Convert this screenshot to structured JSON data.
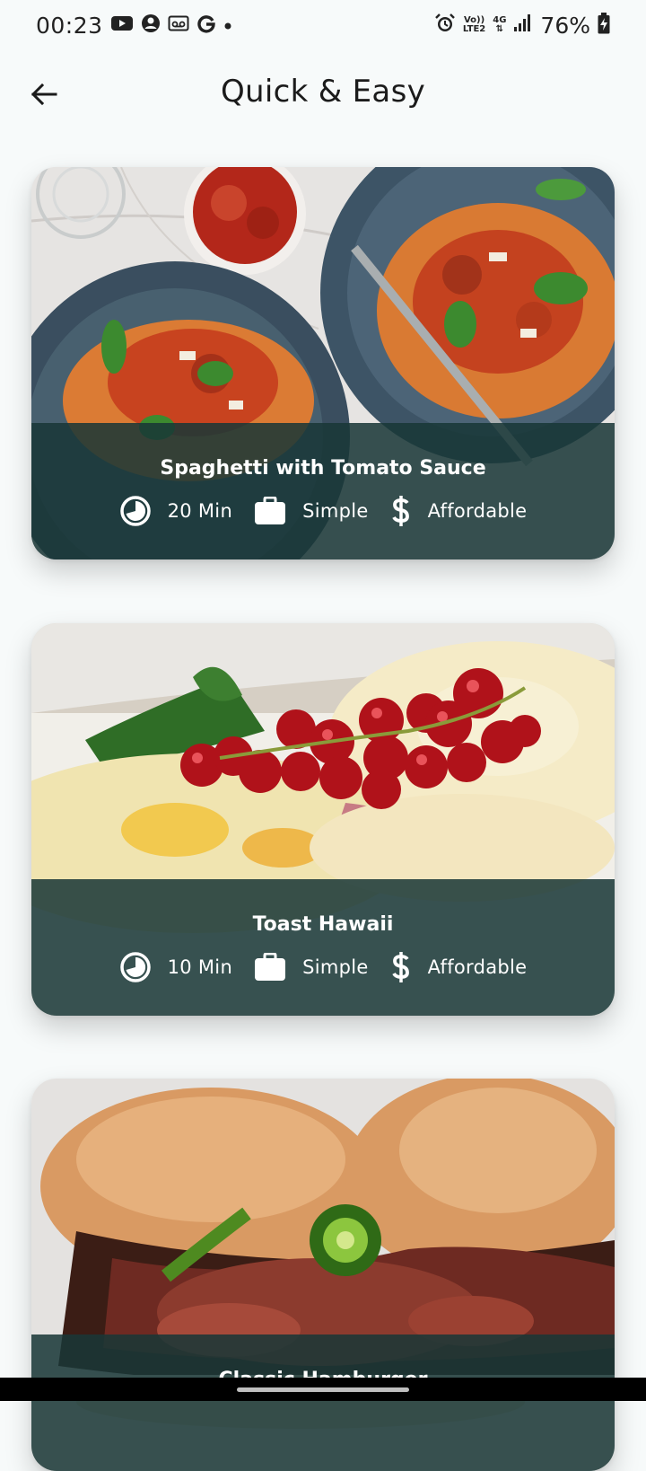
{
  "status_bar": {
    "time": "00:23",
    "battery_percent": "76%",
    "network_top": "Vo))",
    "network_bottom": "LTE2",
    "generation": "4G",
    "left_icons": [
      "youtube-icon",
      "account-circle-icon",
      "voicemail-icon",
      "google-icon",
      "dot-icon"
    ],
    "right_icons": [
      "alarm-icon",
      "signal-icon",
      "battery-charging-icon"
    ]
  },
  "app_bar": {
    "title": "Quick & Easy",
    "back_icon": "arrow-back-icon"
  },
  "meals": [
    {
      "title": "Spaghetti with Tomato Sauce",
      "duration": "20 Min",
      "complexity": "Simple",
      "affordability": "Affordable"
    },
    {
      "title": "Toast Hawaii",
      "duration": "10 Min",
      "complexity": "Simple",
      "affordability": "Affordable"
    },
    {
      "title": "Classic Hamburger"
    }
  ],
  "meta_icons": {
    "duration": "clock-icon",
    "complexity": "briefcase-icon",
    "affordability": "dollar-icon"
  },
  "colors": {
    "overlay": "#193737",
    "background": "#f7fafa",
    "text_on_overlay": "#ffffff"
  }
}
